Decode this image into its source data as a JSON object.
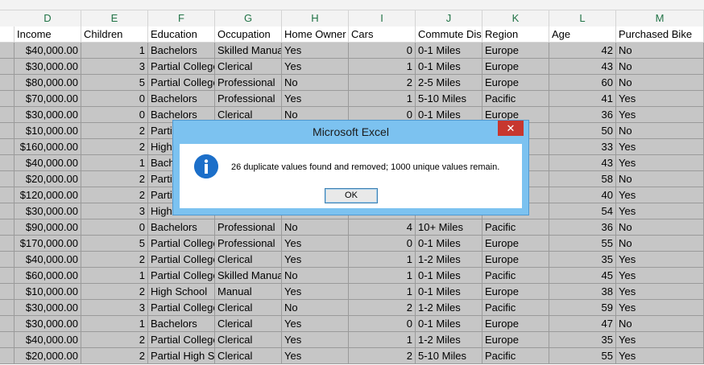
{
  "columns": [
    "D",
    "E",
    "F",
    "G",
    "H",
    "I",
    "J",
    "K",
    "L",
    "M"
  ],
  "headers": [
    "Income",
    "Children",
    "Education",
    "Occupation",
    "Home Owner",
    "Cars",
    "Commute Distance",
    "Region",
    "Age",
    "Purchased Bike"
  ],
  "rows": [
    [
      "$40,000.00",
      "1",
      "Bachelors",
      "Skilled Manual",
      "Yes",
      "0",
      "0-1 Miles",
      "Europe",
      "42",
      "No"
    ],
    [
      "$30,000.00",
      "3",
      "Partial College",
      "Clerical",
      "Yes",
      "1",
      "0-1 Miles",
      "Europe",
      "43",
      "No"
    ],
    [
      "$80,000.00",
      "5",
      "Partial College",
      "Professional",
      "No",
      "2",
      "2-5 Miles",
      "Europe",
      "60",
      "No"
    ],
    [
      "$70,000.00",
      "0",
      "Bachelors",
      "Professional",
      "Yes",
      "1",
      "5-10 Miles",
      "Pacific",
      "41",
      "Yes"
    ],
    [
      "$30,000.00",
      "0",
      "Bachelors",
      "Clerical",
      "No",
      "0",
      "0-1 Miles",
      "Europe",
      "36",
      "Yes"
    ],
    [
      "$10,000.00",
      "2",
      "Partial High School",
      "",
      "",
      "",
      "",
      "",
      "50",
      "No"
    ],
    [
      "$160,000.00",
      "2",
      "High School",
      "",
      "",
      "",
      "",
      "",
      "33",
      "Yes"
    ],
    [
      "$40,000.00",
      "1",
      "Bachelors",
      "",
      "",
      "",
      "",
      "",
      "43",
      "Yes"
    ],
    [
      "$20,000.00",
      "2",
      "Partial College",
      "",
      "",
      "",
      "",
      "",
      "58",
      "No"
    ],
    [
      "$120,000.00",
      "2",
      "Partial College",
      "",
      "",
      "",
      "",
      "",
      "40",
      "Yes"
    ],
    [
      "$30,000.00",
      "3",
      "High School",
      "",
      "",
      "",
      "",
      "",
      "54",
      "Yes"
    ],
    [
      "$90,000.00",
      "0",
      "Bachelors",
      "Professional",
      "No",
      "4",
      "10+ Miles",
      "Pacific",
      "36",
      "No"
    ],
    [
      "$170,000.00",
      "5",
      "Partial College",
      "Professional",
      "Yes",
      "0",
      "0-1 Miles",
      "Europe",
      "55",
      "No"
    ],
    [
      "$40,000.00",
      "2",
      "Partial College",
      "Clerical",
      "Yes",
      "1",
      "1-2 Miles",
      "Europe",
      "35",
      "Yes"
    ],
    [
      "$60,000.00",
      "1",
      "Partial College",
      "Skilled Manual",
      "No",
      "1",
      "0-1 Miles",
      "Pacific",
      "45",
      "Yes"
    ],
    [
      "$10,000.00",
      "2",
      "High School",
      "Manual",
      "Yes",
      "1",
      "0-1 Miles",
      "Europe",
      "38",
      "Yes"
    ],
    [
      "$30,000.00",
      "3",
      "Partial College",
      "Clerical",
      "No",
      "2",
      "1-2 Miles",
      "Pacific",
      "59",
      "Yes"
    ],
    [
      "$30,000.00",
      "1",
      "Bachelors",
      "Clerical",
      "Yes",
      "0",
      "0-1 Miles",
      "Europe",
      "47",
      "No"
    ],
    [
      "$40,000.00",
      "2",
      "Partial College",
      "Clerical",
      "Yes",
      "1",
      "1-2 Miles",
      "Europe",
      "35",
      "Yes"
    ],
    [
      "$20,000.00",
      "2",
      "Partial High School",
      "Clerical",
      "Yes",
      "2",
      "5-10 Miles",
      "Pacific",
      "55",
      "Yes"
    ]
  ],
  "dialog": {
    "title": "Microsoft Excel",
    "close_label": "✕",
    "icon_glyph": "i",
    "message": "26 duplicate values found and removed; 1000 unique values remain.",
    "ok_label": "OK"
  },
  "colors": {
    "header_text": "#217346",
    "selection_fill": "#c6c6c6",
    "dialog_frame": "#7cc2f0",
    "close_button": "#c7372f",
    "info_icon": "#1c6fc9"
  },
  "icons": {
    "dialog_icon": "info-icon",
    "close": "close-icon"
  }
}
